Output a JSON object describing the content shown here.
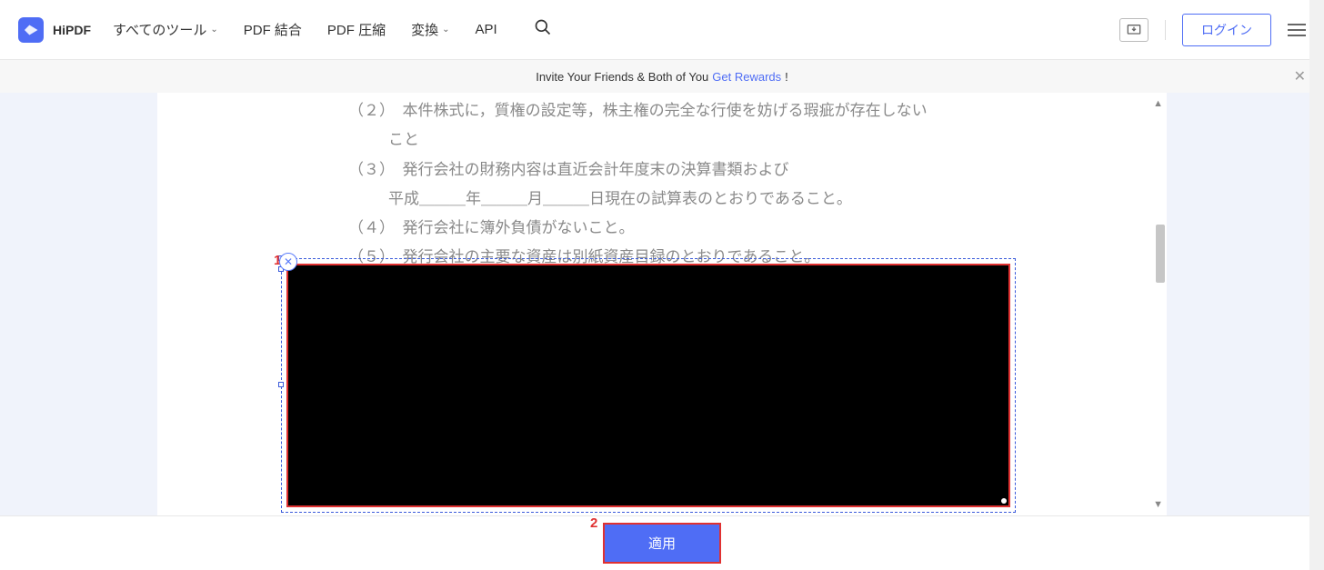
{
  "header": {
    "brand": "HiPDF",
    "nav": {
      "tools": "すべてのツール",
      "merge": "PDF 結合",
      "compress": "PDF 圧縮",
      "convert": "変換",
      "api": "API"
    },
    "login": "ログイン"
  },
  "banner": {
    "prefix": "Invite Your Friends & Both of You ",
    "link": "Get Rewards",
    "suffix": " !"
  },
  "document": {
    "lines": [
      "（２）　本件株式に，質権の設定等，株主権の完全な行使を妨げる瑕疵が存在しない",
      "こと",
      "（３）　発行会社の財務内容は直近会計年度末の決算書類および",
      "平成＿＿＿年＿＿＿月＿＿＿日現在の試算表のとおりであること。",
      "（４）　発行会社に簿外負債がないこと。",
      "（５）　発行会社の主要な資産は別紙資産目録のとおりであること。"
    ]
  },
  "annotations": {
    "label1": "1",
    "label2": "2"
  },
  "footer": {
    "apply": "適用"
  }
}
